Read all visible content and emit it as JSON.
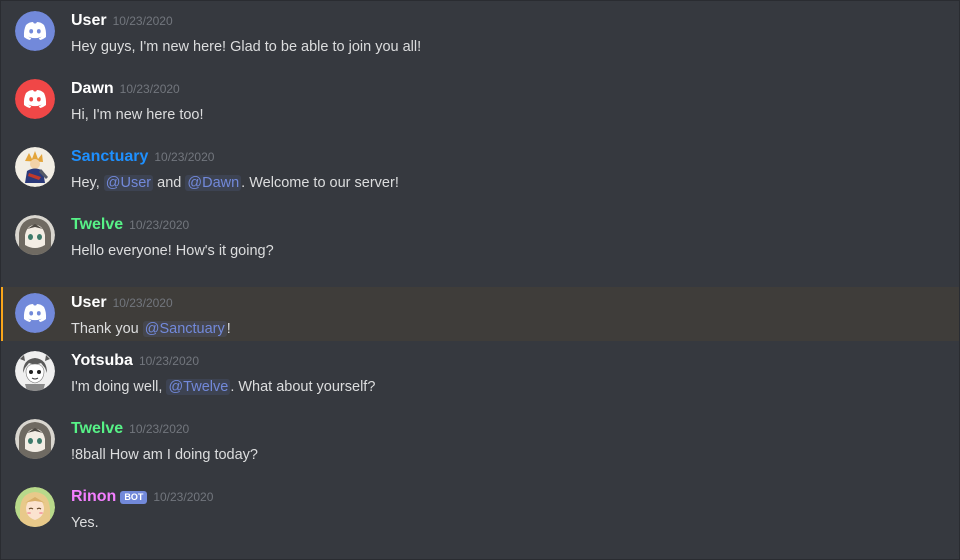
{
  "colors": {
    "background": "#36393f",
    "highlight_bg": "#3f3d3a",
    "highlight_border": "#faa61a",
    "mention": "#7289da",
    "timestamp": "#72767d",
    "discord_blurple": "#7289da",
    "discord_red": "#f04747"
  },
  "messages": [
    {
      "username": "User",
      "username_color": "#ffffff",
      "timestamp": "10/23/2020",
      "avatar_icon": "discord-logo-blurple-icon",
      "text": "Hey guys, I'm new here! Glad to be able to join you all!"
    },
    {
      "username": "Dawn",
      "username_color": "#ffffff",
      "timestamp": "10/23/2020",
      "avatar_icon": "discord-logo-red-icon",
      "text": "Hi, I'm new here too!"
    },
    {
      "username": "Sanctuary",
      "username_color": "#1e90ff",
      "timestamp": "10/23/2020",
      "avatar_icon": "sanctuary-avatar-icon",
      "text_parts": [
        "Hey, ",
        "@User",
        " and ",
        "@Dawn",
        ". Welcome to our server!"
      ]
    },
    {
      "username": "Twelve",
      "username_color": "#57f287",
      "timestamp": "10/23/2020",
      "avatar_icon": "twelve-avatar-icon",
      "text": "Hello everyone! How's it going?"
    },
    {
      "username": "User",
      "username_color": "#ffffff",
      "timestamp": "10/23/2020",
      "avatar_icon": "discord-logo-blurple-icon",
      "text_parts": [
        "Thank you ",
        "@Sanctuary",
        "!"
      ],
      "highlighted": true
    },
    {
      "username": "Yotsuba",
      "username_color": "#ffffff",
      "timestamp": "10/23/2020",
      "avatar_icon": "yotsuba-avatar-icon",
      "text_parts": [
        "I'm doing well, ",
        "@Twelve",
        ". What about yourself?"
      ]
    },
    {
      "username": "Twelve",
      "username_color": "#57f287",
      "timestamp": "10/23/2020",
      "avatar_icon": "twelve-avatar-icon",
      "text": "!8ball How am I doing today?"
    },
    {
      "username": "Rinon",
      "username_color": "#f47fff",
      "bot_tag": "BOT",
      "timestamp": "10/23/2020",
      "avatar_icon": "rinon-avatar-icon",
      "text": "Yes."
    }
  ]
}
